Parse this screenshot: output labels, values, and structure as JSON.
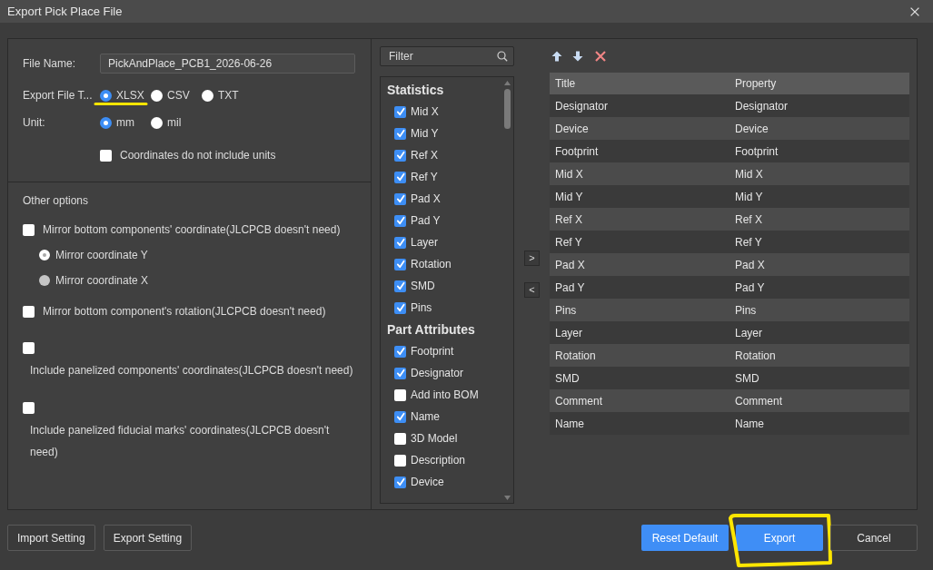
{
  "window": {
    "title": "Export Pick Place File"
  },
  "file_name": {
    "label": "File Name:",
    "value": "PickAndPlace_PCB1_2026-06-26"
  },
  "export_file_type": {
    "label": "Export File T...",
    "options": [
      {
        "label": "XLSX",
        "selected": true,
        "marked": true
      },
      {
        "label": "CSV",
        "selected": false,
        "marked": false
      },
      {
        "label": "TXT",
        "selected": false,
        "marked": false
      }
    ]
  },
  "unit": {
    "label": "Unit:",
    "options": [
      {
        "label": "mm",
        "selected": true
      },
      {
        "label": "mil",
        "selected": false
      }
    ]
  },
  "coordinates_without_units": {
    "label": "Coordinates do not include units",
    "checked": false
  },
  "other_options": {
    "title": "Other options",
    "items": [
      {
        "kind": "checkbox",
        "label": "Mirror bottom components' coordinate(JLCPCB doesn't need)",
        "checked": false,
        "label_below": false
      },
      {
        "kind": "radio",
        "label": "Mirror coordinate Y",
        "selected": true,
        "disabled": true
      },
      {
        "kind": "radio",
        "label": "Mirror coordinate X",
        "selected": false,
        "disabled": true
      },
      {
        "kind": "checkbox",
        "label": "Mirror bottom component's rotation(JLCPCB doesn't need)",
        "checked": false,
        "label_below": false
      },
      {
        "kind": "checkbox",
        "label": "Include panelized components' coordinates(JLCPCB doesn't need)",
        "checked": false,
        "label_below": true
      },
      {
        "kind": "checkbox",
        "label": "Include panelized fiducial marks' coordinates(JLCPCB doesn't need)",
        "checked": false,
        "label_below": true
      }
    ]
  },
  "filter": {
    "placeholder": "Filter"
  },
  "field_groups": [
    {
      "title": "Statistics",
      "items": [
        {
          "label": "Mid X",
          "checked": true
        },
        {
          "label": "Mid Y",
          "checked": true
        },
        {
          "label": "Ref X",
          "checked": true
        },
        {
          "label": "Ref Y",
          "checked": true
        },
        {
          "label": "Pad X",
          "checked": true
        },
        {
          "label": "Pad Y",
          "checked": true
        },
        {
          "label": "Layer",
          "checked": true
        },
        {
          "label": "Rotation",
          "checked": true
        },
        {
          "label": "SMD",
          "checked": true
        },
        {
          "label": "Pins",
          "checked": true
        }
      ]
    },
    {
      "title": "Part Attributes",
      "items": [
        {
          "label": "Footprint",
          "checked": true
        },
        {
          "label": "Designator",
          "checked": true
        },
        {
          "label": "Add into BOM",
          "checked": false
        },
        {
          "label": "Name",
          "checked": true
        },
        {
          "label": "3D Model",
          "checked": false
        },
        {
          "label": "Description",
          "checked": false
        },
        {
          "label": "Device",
          "checked": true
        }
      ]
    }
  ],
  "transfer_buttons": [
    ">",
    "<"
  ],
  "table": {
    "columns": [
      "Title",
      "Property"
    ],
    "rows": [
      [
        "Designator",
        "Designator"
      ],
      [
        "Device",
        "Device"
      ],
      [
        "Footprint",
        "Footprint"
      ],
      [
        "Mid X",
        "Mid X"
      ],
      [
        "Mid Y",
        "Mid Y"
      ],
      [
        "Ref X",
        "Ref X"
      ],
      [
        "Ref Y",
        "Ref Y"
      ],
      [
        "Pad X",
        "Pad X"
      ],
      [
        "Pad Y",
        "Pad Y"
      ],
      [
        "Pins",
        "Pins"
      ],
      [
        "Layer",
        "Layer"
      ],
      [
        "Rotation",
        "Rotation"
      ],
      [
        "SMD",
        "SMD"
      ],
      [
        "Comment",
        "Comment"
      ],
      [
        "Name",
        "Name"
      ]
    ]
  },
  "footer": {
    "left_buttons": [
      {
        "label": "Import Setting",
        "kind": "default"
      },
      {
        "label": "Export Setting",
        "kind": "default"
      }
    ],
    "right_buttons": [
      {
        "label": "Reset Default",
        "kind": "primary",
        "marked": false
      },
      {
        "label": "Export",
        "kind": "primary",
        "marked": true
      },
      {
        "label": "Cancel",
        "kind": "default",
        "marked": false
      }
    ]
  }
}
